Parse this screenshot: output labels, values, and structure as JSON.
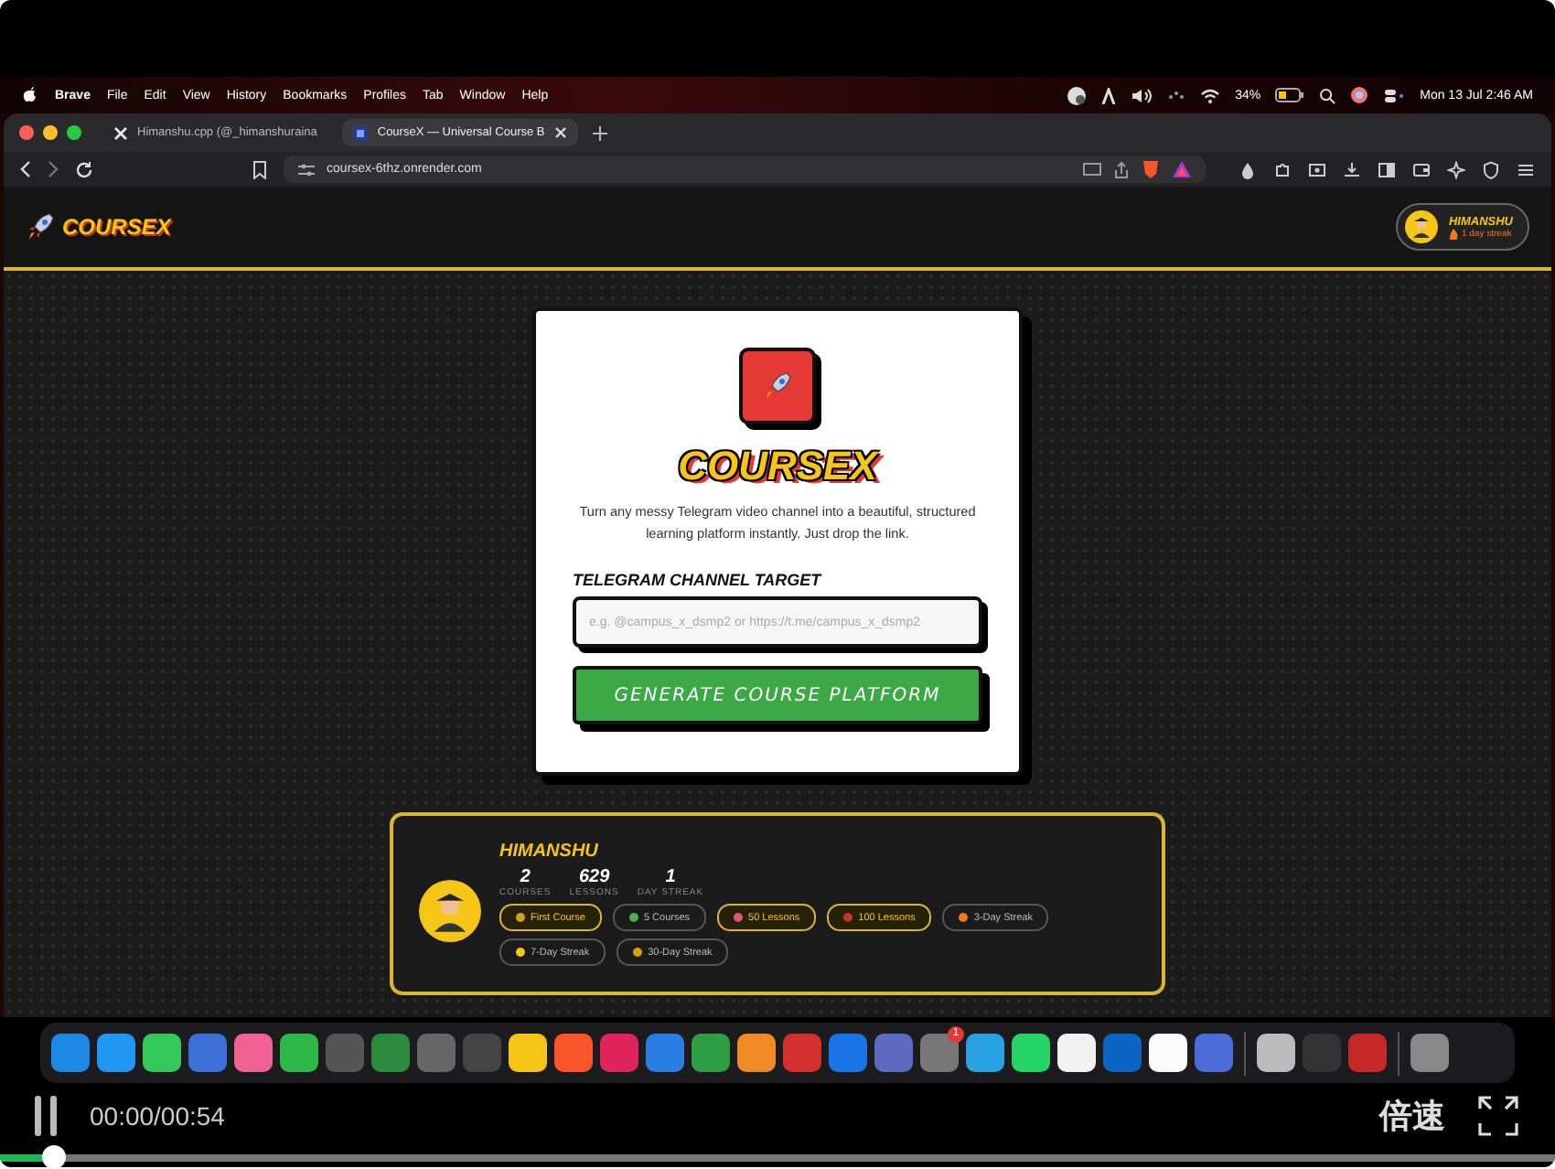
{
  "menu_bar": {
    "app": "Brave",
    "menus": [
      "File",
      "Edit",
      "View",
      "History",
      "Bookmarks",
      "Profiles",
      "Tab",
      "Window",
      "Help"
    ],
    "battery": "34%",
    "clock": "Mon 13 Jul  2:46 AM"
  },
  "browser": {
    "tabs": [
      {
        "title": "Himanshu.cpp (@_himanshuraina",
        "selected": false
      },
      {
        "title": "CourseX — Universal Course B",
        "selected": true
      }
    ],
    "url": "coursex-6thz.onrender.com"
  },
  "page": {
    "logo": "COURSEX",
    "user": {
      "name": "HIMANSHU",
      "streak": "1 day streak"
    },
    "hero": {
      "title": "COURSEX",
      "description": "Turn any messy Telegram video channel into a beautiful, structured learning platform instantly. Just drop the link.",
      "field_label": "TELEGRAM CHANNEL TARGET",
      "placeholder": "e.g. @campus_x_dsmp2 or https://t.me/campus_x_dsmp2",
      "button": "GENERATE COURSE PLATFORM"
    },
    "profile": {
      "name": "HIMANSHU",
      "stats": [
        {
          "value": "2",
          "label": "COURSES"
        },
        {
          "value": "629",
          "label": "LESSONS"
        },
        {
          "value": "1",
          "label": "DAY STREAK"
        }
      ],
      "badges": [
        {
          "label": "First Course",
          "earned": true,
          "color": "#c9a227"
        },
        {
          "label": "5 Courses",
          "earned": false,
          "color": "#4caf50"
        },
        {
          "label": "50 Lessons",
          "earned": true,
          "color": "#e0567a"
        },
        {
          "label": "100 Lessons",
          "earned": true,
          "color": "#c0392b"
        },
        {
          "label": "3-Day Streak",
          "earned": false,
          "color": "#f07a1a"
        },
        {
          "label": "7-Day Streak",
          "earned": false,
          "color": "#f5c518"
        },
        {
          "label": "30-Day Streak",
          "earned": false,
          "color": "#d4a017"
        }
      ]
    }
  },
  "dock": {
    "notification_badge": "1"
  },
  "player": {
    "playing": true,
    "time": "00:00/00:54",
    "speed": "倍速",
    "level": 0.03
  }
}
